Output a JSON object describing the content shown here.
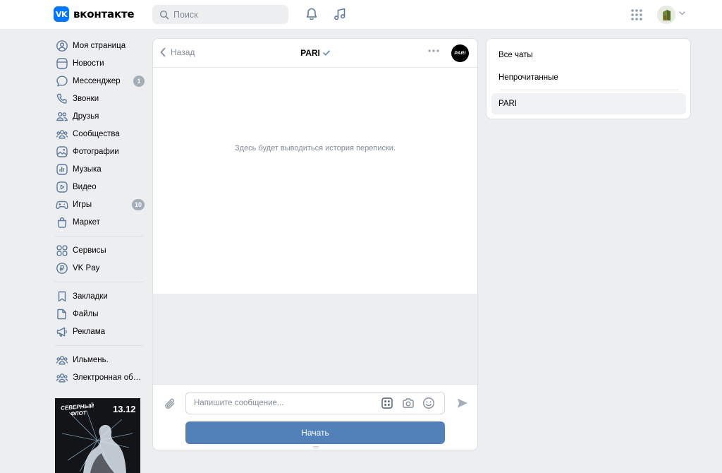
{
  "header": {
    "logo_mark": "VK",
    "logo_text": "вконтакте",
    "search_placeholder": "Поиск"
  },
  "sidebar": {
    "groups": [
      [
        {
          "name": "my-page",
          "icon": "user-circle-icon",
          "label": "Моя страница"
        },
        {
          "name": "news",
          "icon": "news-icon",
          "label": "Новости"
        },
        {
          "name": "messenger",
          "icon": "chat-bubble-icon",
          "label": "Мессенджер",
          "badge": "1"
        },
        {
          "name": "calls",
          "icon": "phone-icon",
          "label": "Звонки"
        },
        {
          "name": "friends",
          "icon": "friends-icon",
          "label": "Друзья"
        },
        {
          "name": "communities",
          "icon": "communities-icon",
          "label": "Сообщества"
        },
        {
          "name": "photos",
          "icon": "photo-icon",
          "label": "Фотографии"
        },
        {
          "name": "music",
          "icon": "music-icon",
          "label": "Музыка"
        },
        {
          "name": "video",
          "icon": "video-icon",
          "label": "Видео"
        },
        {
          "name": "games",
          "icon": "gamepad-icon",
          "label": "Игры",
          "badge": "10"
        },
        {
          "name": "market",
          "icon": "bag-icon",
          "label": "Маркет"
        }
      ],
      [
        {
          "name": "services",
          "icon": "services-icon",
          "label": "Сервисы"
        },
        {
          "name": "vkpay",
          "icon": "vkpay-icon",
          "label": "VK Pay"
        }
      ],
      [
        {
          "name": "bookmarks",
          "icon": "bookmark-icon",
          "label": "Закладки"
        },
        {
          "name": "files",
          "icon": "file-icon",
          "label": "Файлы"
        },
        {
          "name": "ads",
          "icon": "megaphone-icon",
          "label": "Реклама"
        }
      ],
      [
        {
          "name": "ilmen",
          "icon": "community-icon",
          "label": "Ильмень."
        },
        {
          "name": "e-community",
          "icon": "community-icon",
          "label": "Электронная общ..."
        }
      ]
    ],
    "promo": {
      "date": "13.12",
      "title_line1": "СЕВЕРНЫЙ",
      "title_line2": "ФЛОТ"
    }
  },
  "chat": {
    "back_label": "Назад",
    "title": "PARI",
    "avatar_text": "PARI",
    "empty_text": "Здесь будет выводиться история переписки.",
    "input_placeholder": "Напишите сообщение...",
    "start_label": "Начать"
  },
  "right_panel": {
    "filters": [
      {
        "label": "Все чаты",
        "selected": false
      },
      {
        "label": "Непрочитанные",
        "selected": false
      },
      {
        "label": "PARI",
        "selected": true
      }
    ]
  },
  "colors": {
    "accent": "#0077ff",
    "button": "#5181b8",
    "icon": "#5c7a9c",
    "muted": "#818c99",
    "badge": "#a3adb8",
    "background": "#edeef0"
  }
}
